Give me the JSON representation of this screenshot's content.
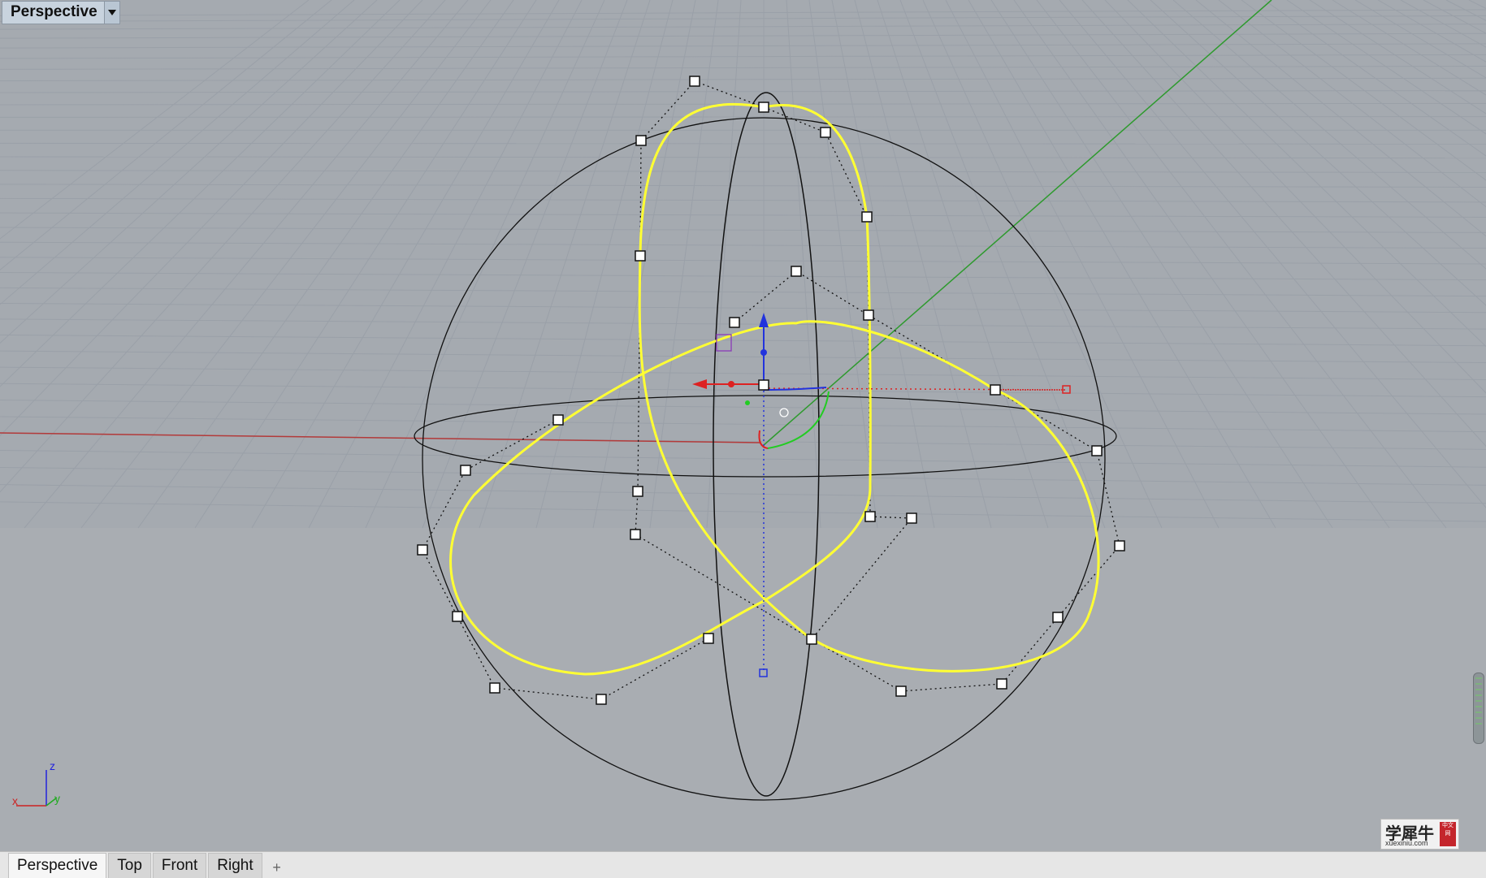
{
  "viewport": {
    "title": "Perspective",
    "dropdown_icon": "caret-down-icon",
    "axis_labels": {
      "x": "x",
      "y": "y",
      "z": "z"
    }
  },
  "tabs": {
    "items": [
      {
        "label": "Perspective",
        "active": true
      },
      {
        "label": "Top"
      },
      {
        "label": "Front"
      },
      {
        "label": "Right"
      }
    ],
    "add_icon": "plus-icon"
  },
  "watermark": {
    "text": "学犀牛",
    "url": "xuexiniu.com",
    "badge": "中文网"
  },
  "colors": {
    "background": "#a9adb2",
    "grid": "#9aa0a8",
    "curve": "#ffff33",
    "x_axis": "#cc2222",
    "y_axis": "#22aa22",
    "z_axis": "#2222dd"
  }
}
